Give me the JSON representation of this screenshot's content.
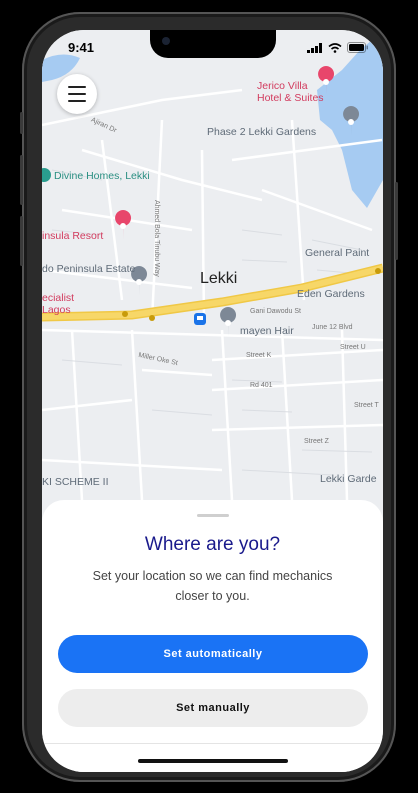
{
  "status_bar": {
    "time": "9:41"
  },
  "map": {
    "center_label": "Lekki",
    "labels": {
      "jerico": "Jerico Villa\nHotel & Suites",
      "phase2": "Phase 2 Lekki Gardens",
      "divine": "Divine Homes, Lekki",
      "insula": "insula Resort",
      "general": "General Paint",
      "peninsula": "do Peninsula Estate",
      "eden": "Eden Gardens",
      "specialist": "ecialist\nLagos",
      "mayen": "mayen Hair",
      "scheme": "KI SCHEME II",
      "gardens": "Lekki Garde",
      "ajiran": "Ajiran Dr",
      "gani": "Gani Dawodu St",
      "june12": "June 12 Blvd",
      "street_u": "Street U",
      "street_k": "Street K",
      "rd401": "Rd 401",
      "street_z": "Street Z",
      "street_t": "Street T",
      "miller": "Miller Oke St",
      "ahmed": "Ahmed Bola Tinubu Way"
    }
  },
  "sheet": {
    "title": "Where are you?",
    "subtitle": "Set your location so we can find mechanics closer to you.",
    "primary_button": "Set automatically",
    "secondary_button": "Set manually"
  },
  "colors": {
    "accent": "#1a73f5",
    "title": "#1a1a8c",
    "road": "#f7d768",
    "water": "#a6cbf2",
    "poi_red": "#e8466b",
    "poi_teal": "#2a9d8f"
  }
}
